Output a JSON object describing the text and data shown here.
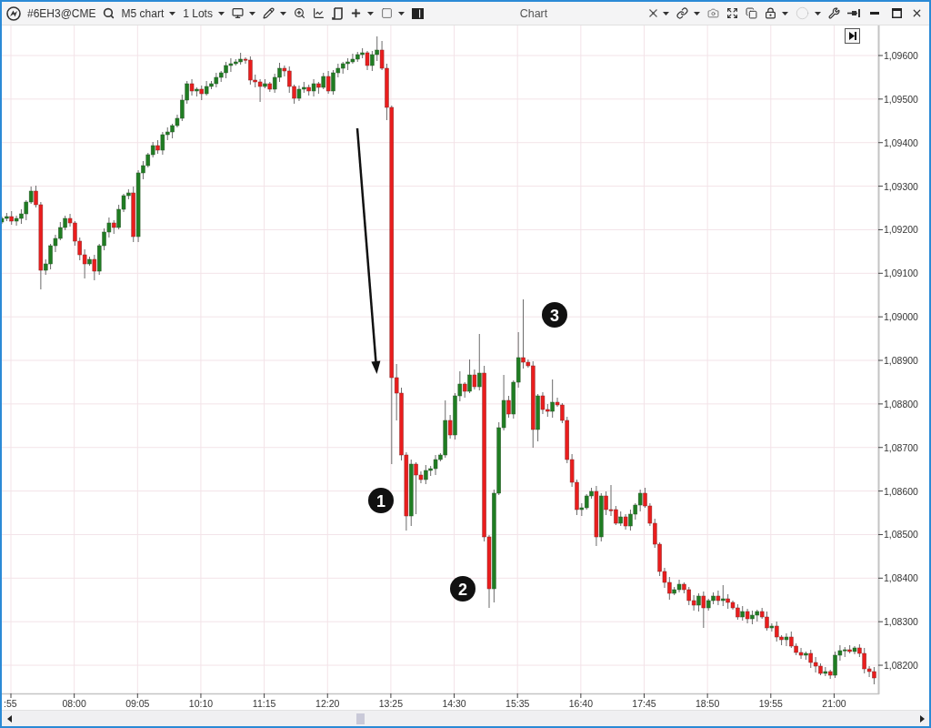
{
  "window": {
    "title": "Chart"
  },
  "toolbar": {
    "symbol": "#6EH3@CME",
    "timeframe": "M5 chart",
    "lots": "1 Lots"
  },
  "chart": {
    "price_labels": [
      "1,09600",
      "1,09500",
      "1,09400",
      "1,09300",
      "1,09200",
      "1,09100",
      "1,09000",
      "1,08900",
      "1,08800",
      "1,08700",
      "1,08600",
      "1,08500",
      "1,08400",
      "1,08300",
      "1,08200"
    ],
    "time_labels": [
      ":55",
      "08:00",
      "09:05",
      "10:10",
      "11:15",
      "12:20",
      "13:25",
      "14:30",
      "15:35",
      "16:40",
      "17:45",
      "18:50",
      "19:55",
      "21:00"
    ],
    "annotations": [
      {
        "label": "1"
      },
      {
        "label": "2"
      },
      {
        "label": "3"
      }
    ]
  }
}
